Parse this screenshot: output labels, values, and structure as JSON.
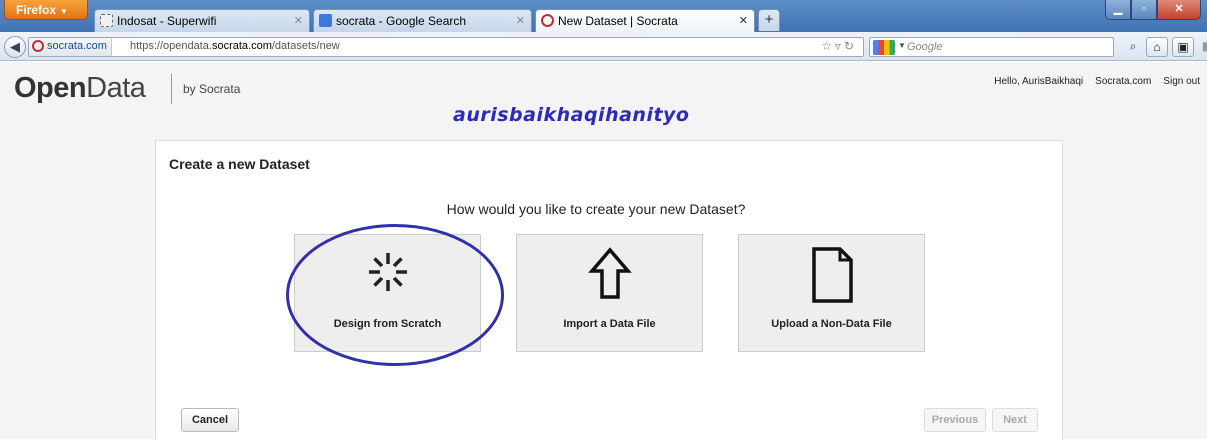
{
  "browser": {
    "menu_label": "Firefox",
    "tabs": [
      {
        "title": "Indosat - Superwifi",
        "active": false
      },
      {
        "title": "socrata - Google Search",
        "active": false
      },
      {
        "title": "New Dataset | Socrata",
        "active": true
      }
    ],
    "new_tab_label": "+",
    "site_identity": "socrata.com",
    "url_prefix": "https://opendata.",
    "url_domain": "socrata.com",
    "url_path": "/datasets/new",
    "search_placeholder": "Google"
  },
  "header": {
    "logo_open": "Open",
    "logo_data": "Data",
    "by_line": "by Socrata",
    "watermark": "aurisbaikhaqihanityo",
    "user_nav": [
      "Hello, AurisBaikhaqi",
      "Socrata.com",
      "Sign out"
    ]
  },
  "wizard": {
    "title": "Create a new Dataset",
    "question": "How would you like to create your new Dataset?",
    "options": [
      {
        "label": "Design from Scratch",
        "icon": "spinner-icon",
        "highlighted": true
      },
      {
        "label": "Import a Data File",
        "icon": "upload-arrow-icon",
        "highlighted": false
      },
      {
        "label": "Upload a Non-Data File",
        "icon": "document-icon",
        "highlighted": false
      }
    ],
    "cancel_label": "Cancel",
    "previous_label": "Previous",
    "next_label": "Next"
  },
  "colors": {
    "annotation_circle": "#3030a8",
    "watermark": "#2b2bb5"
  }
}
